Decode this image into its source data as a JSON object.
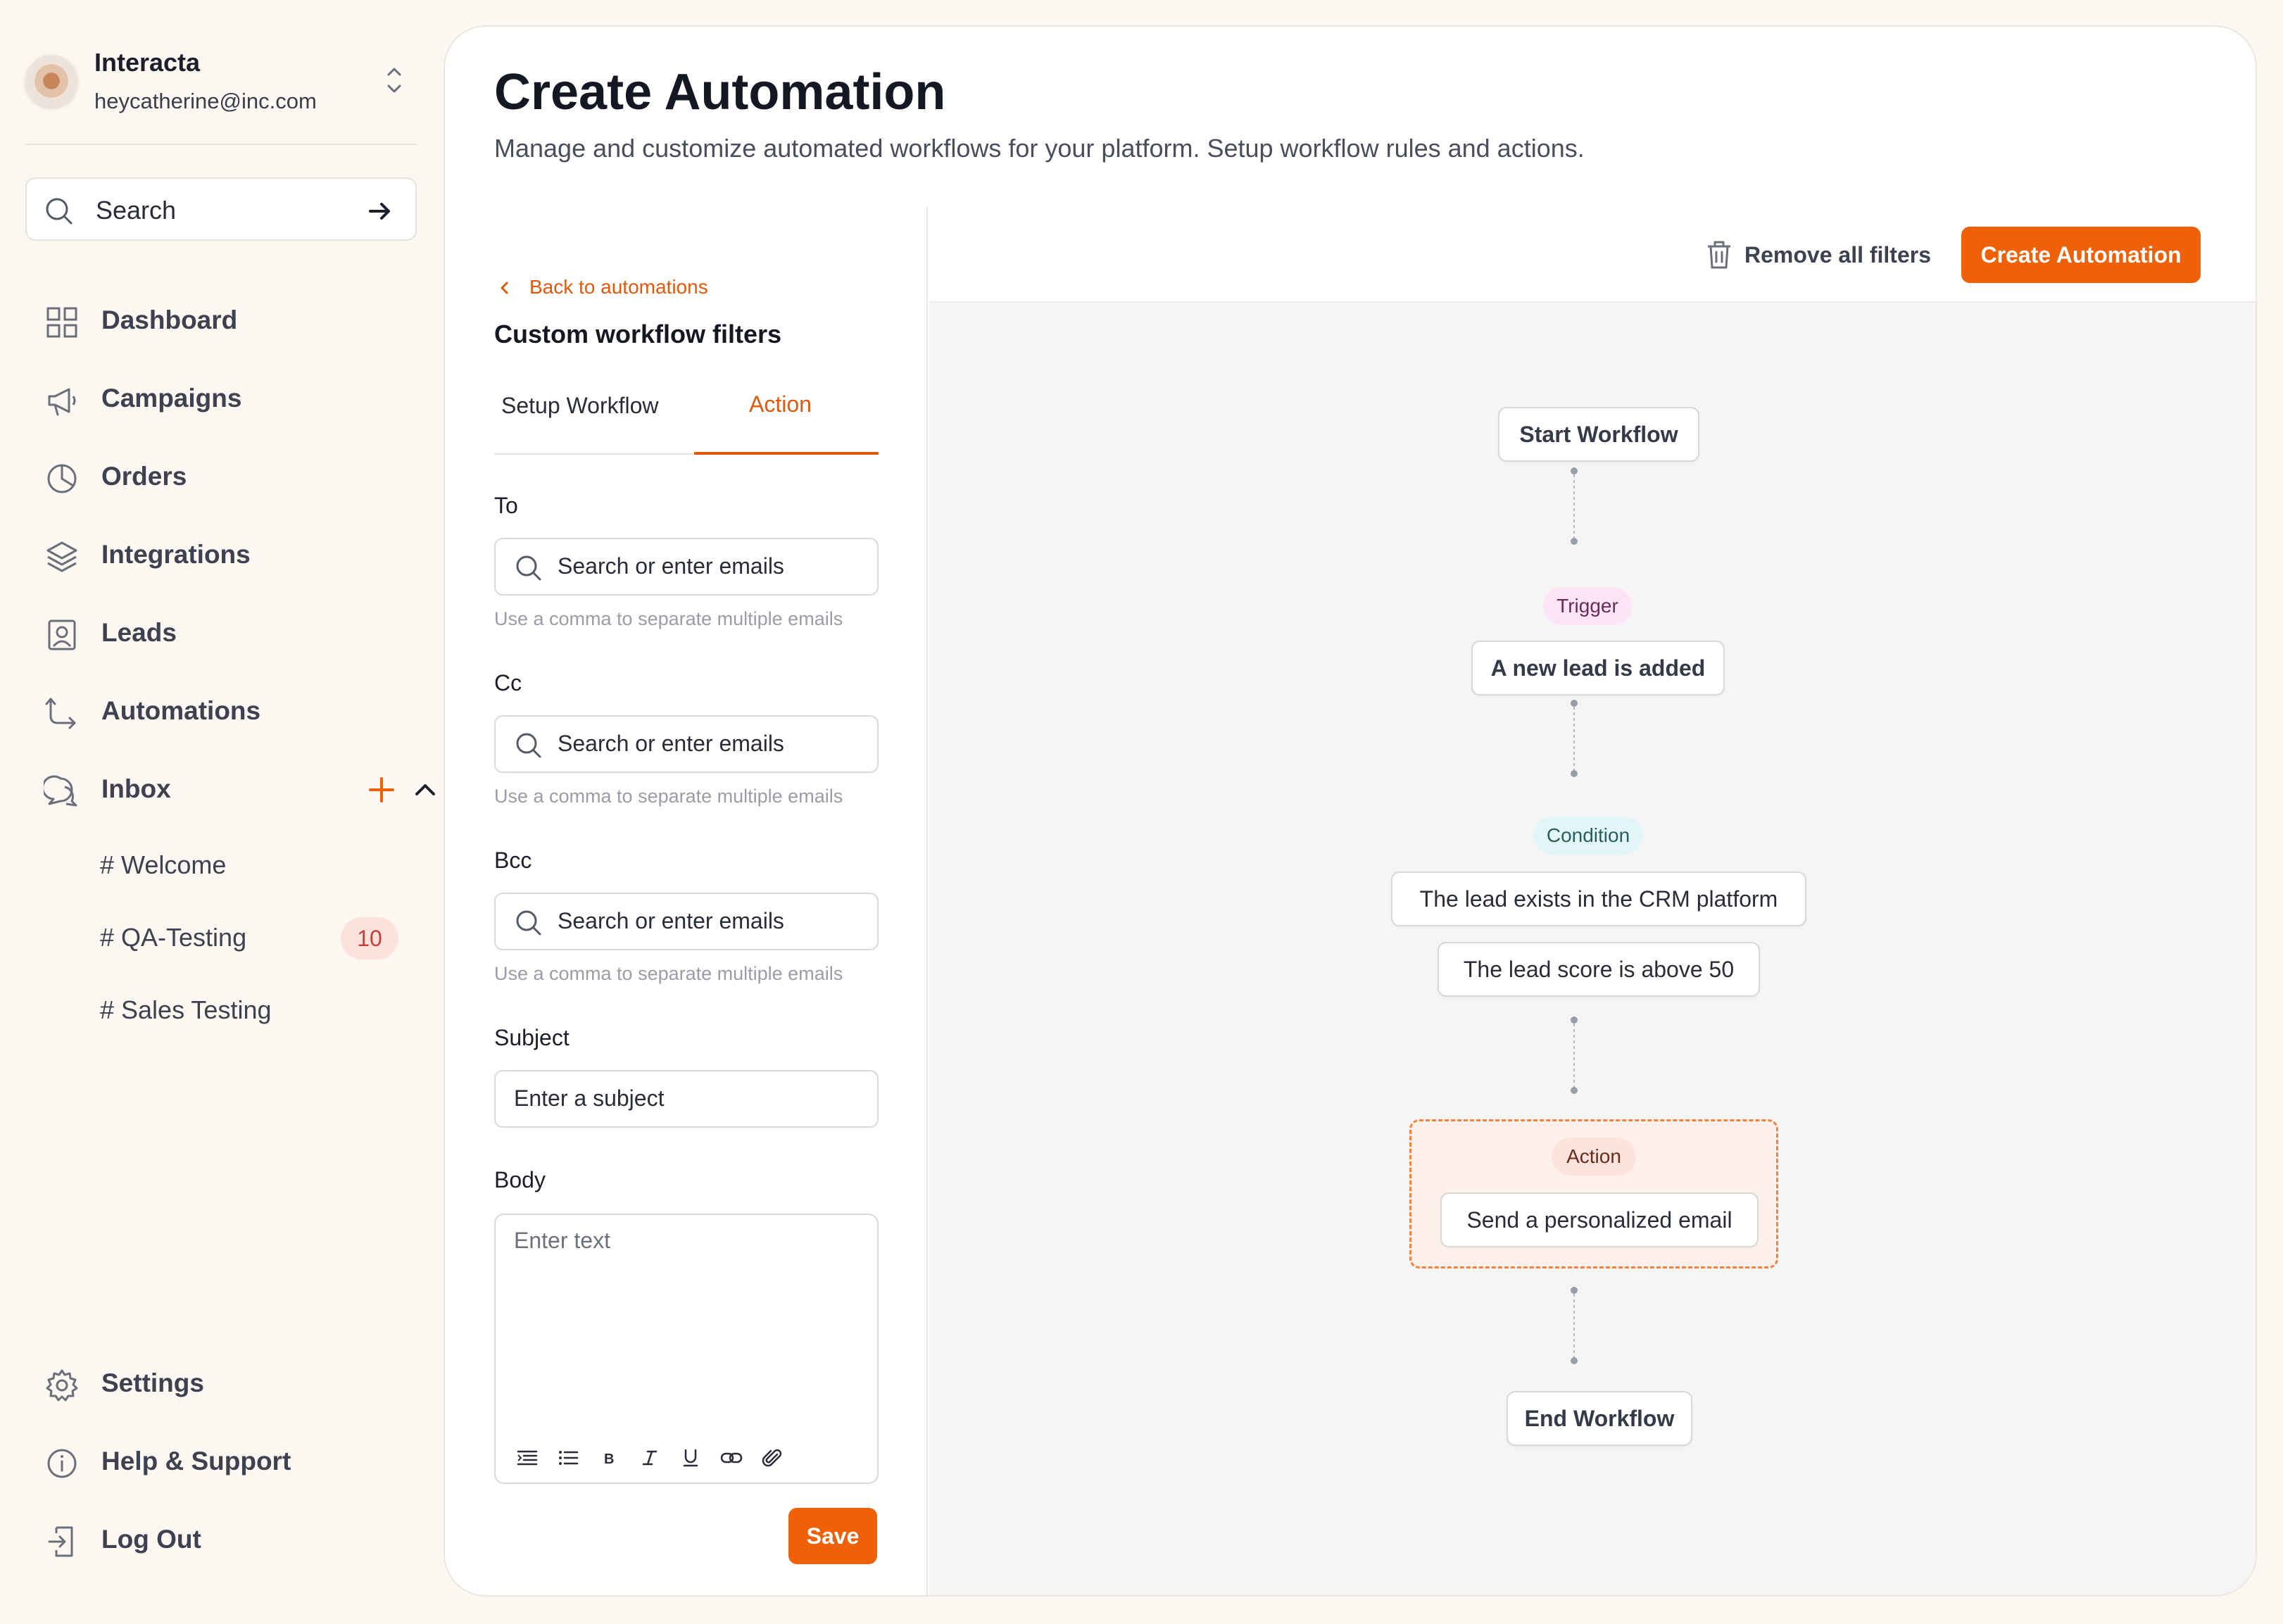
{
  "account": {
    "name": "Interacta",
    "email": "heycatherine@inc.com"
  },
  "sidebar": {
    "search_label": "Search",
    "nav": [
      {
        "label": "Dashboard",
        "icon": "grid-icon"
      },
      {
        "label": "Campaigns",
        "icon": "megaphone-icon"
      },
      {
        "label": "Orders",
        "icon": "pie-chart-icon"
      },
      {
        "label": "Integrations",
        "icon": "layers-icon"
      },
      {
        "label": "Leads",
        "icon": "contact-icon"
      },
      {
        "label": "Automations",
        "icon": "route-icon"
      },
      {
        "label": "Inbox",
        "icon": "chat-icon"
      }
    ],
    "channels": [
      {
        "label": "# Welcome"
      },
      {
        "label": "# QA-Testing",
        "badge": "10"
      },
      {
        "label": "# Sales Testing"
      }
    ],
    "bottom": [
      {
        "label": "Settings",
        "icon": "gear-icon"
      },
      {
        "label": "Help & Support",
        "icon": "info-icon"
      },
      {
        "label": "Log Out",
        "icon": "logout-icon"
      }
    ]
  },
  "page": {
    "title": "Create Automation",
    "subtitle": "Manage and customize automated workflows for your platform. Setup workflow rules and actions."
  },
  "form": {
    "back_label": "Back to automations",
    "title": "Custom workflow filters",
    "tabs": [
      "Setup Workflow",
      "Action"
    ],
    "active_tab": "Action",
    "to_label": "To",
    "cc_label": "Cc",
    "bcc_label": "Bcc",
    "email_placeholder": "Search or enter emails",
    "email_hint": "Use a comma to separate multiple emails",
    "subject_label": "Subject",
    "subject_placeholder": "Enter a subject",
    "body_label": "Body",
    "body_placeholder": "Enter text",
    "save_label": "Save"
  },
  "toolbar": {
    "remove_filters_label": "Remove all filters",
    "create_label": "Create Automation"
  },
  "workflow": {
    "start": "Start Workflow",
    "trigger_pill": "Trigger",
    "trigger": "A new lead is added",
    "condition_pill": "Condition",
    "condition_1": "The lead exists in the CRM platform",
    "condition_2": "The lead score is above 50",
    "action_pill": "Action",
    "action": "Send a personalized email",
    "end": "End Workflow"
  },
  "colors": {
    "accent": "#ef6109",
    "background": "#fdf7f2",
    "canvas": "#f5f5f6"
  }
}
